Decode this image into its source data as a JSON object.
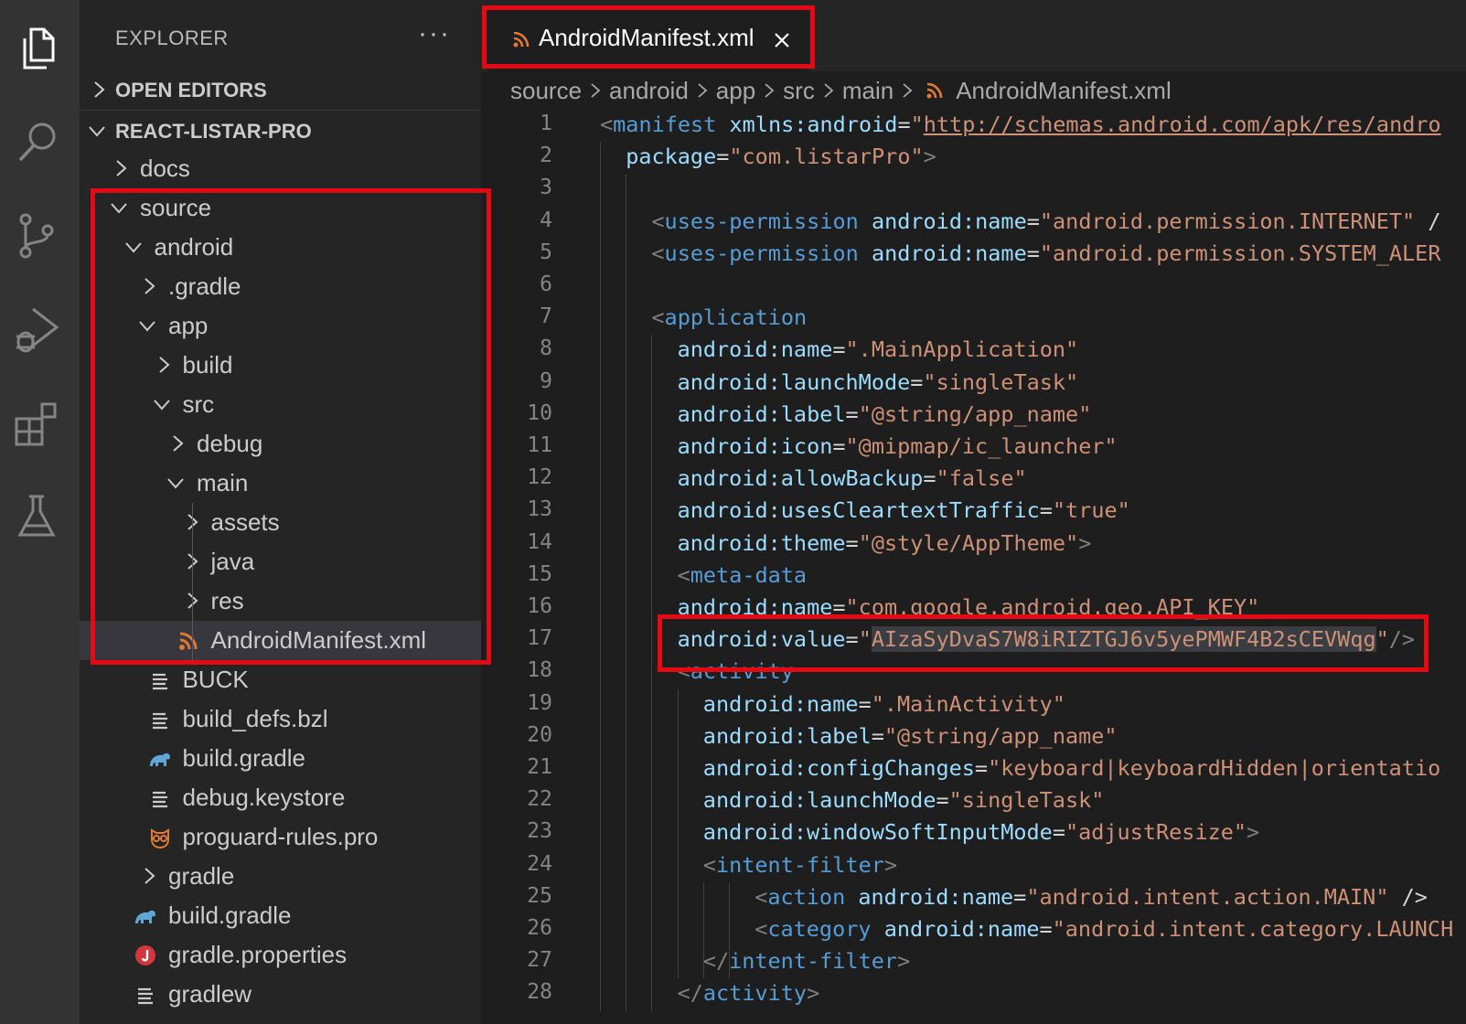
{
  "explorer": {
    "title": "EXPLORER",
    "more": "···",
    "sections": [
      {
        "label": "OPEN EDITORS",
        "expanded": false
      },
      {
        "label": "REACT-LISTAR-PRO",
        "expanded": true
      }
    ],
    "tree": [
      {
        "label": "docs",
        "depth": 0,
        "kind": "folder",
        "expanded": false
      },
      {
        "label": "source",
        "depth": 0,
        "kind": "folder",
        "expanded": true
      },
      {
        "label": "android",
        "depth": 1,
        "kind": "folder",
        "expanded": true
      },
      {
        "label": ".gradle",
        "depth": 2,
        "kind": "folder",
        "expanded": false
      },
      {
        "label": "app",
        "depth": 2,
        "kind": "folder",
        "expanded": true
      },
      {
        "label": "build",
        "depth": 3,
        "kind": "folder",
        "expanded": false
      },
      {
        "label": "src",
        "depth": 3,
        "kind": "folder",
        "expanded": true
      },
      {
        "label": "debug",
        "depth": 4,
        "kind": "folder",
        "expanded": false
      },
      {
        "label": "main",
        "depth": 4,
        "kind": "folder",
        "expanded": true
      },
      {
        "label": "assets",
        "depth": 5,
        "kind": "folder",
        "expanded": false
      },
      {
        "label": "java",
        "depth": 5,
        "kind": "folder",
        "expanded": false
      },
      {
        "label": "res",
        "depth": 5,
        "kind": "folder",
        "expanded": false
      },
      {
        "label": "AndroidManifest.xml",
        "depth": 5,
        "kind": "xml",
        "selected": true
      },
      {
        "label": "BUCK",
        "depth": 3,
        "kind": "text"
      },
      {
        "label": "build_defs.bzl",
        "depth": 3,
        "kind": "text"
      },
      {
        "label": "build.gradle",
        "depth": 3,
        "kind": "gradle"
      },
      {
        "label": "debug.keystore",
        "depth": 3,
        "kind": "text"
      },
      {
        "label": "proguard-rules.pro",
        "depth": 3,
        "kind": "proguard"
      },
      {
        "label": "gradle",
        "depth": 2,
        "kind": "folder",
        "expanded": false
      },
      {
        "label": "build.gradle",
        "depth": 2,
        "kind": "gradle"
      },
      {
        "label": "gradle.properties",
        "depth": 2,
        "kind": "properties"
      },
      {
        "label": "gradlew",
        "depth": 2,
        "kind": "text"
      }
    ]
  },
  "tab": {
    "label": "AndroidManifest.xml",
    "icon": "rss-icon"
  },
  "breadcrumb": [
    "source",
    "android",
    "app",
    "src",
    "main",
    "AndroidManifest.xml"
  ],
  "code_lines": [
    {
      "n": "1",
      "indent": 0,
      "tokens": [
        [
          "br",
          "<"
        ],
        [
          "tag",
          "manifest"
        ],
        [
          "txt",
          " "
        ],
        [
          "attr",
          "xmlns:android"
        ],
        [
          "eq",
          "="
        ],
        [
          "str",
          "\""
        ],
        [
          "url",
          "http://schemas.android.com/apk/res/andro"
        ]
      ]
    },
    {
      "n": "2",
      "indent": 1,
      "tokens": [
        [
          "attr",
          "package"
        ],
        [
          "eq",
          "="
        ],
        [
          "str",
          "\"com.listarPro\""
        ],
        [
          "br",
          ">"
        ]
      ]
    },
    {
      "n": "3",
      "indent": 0,
      "tokens": []
    },
    {
      "n": "4",
      "indent": 2,
      "tokens": [
        [
          "br",
          "<"
        ],
        [
          "tag",
          "uses-permission"
        ],
        [
          "txt",
          " "
        ],
        [
          "attr",
          "android:name"
        ],
        [
          "eq",
          "="
        ],
        [
          "str",
          "\"android.permission.INTERNET\""
        ],
        [
          "txt",
          " /"
        ]
      ]
    },
    {
      "n": "5",
      "indent": 2,
      "tokens": [
        [
          "br",
          "<"
        ],
        [
          "tag",
          "uses-permission"
        ],
        [
          "txt",
          " "
        ],
        [
          "attr",
          "android:name"
        ],
        [
          "eq",
          "="
        ],
        [
          "str",
          "\"android.permission.SYSTEM_ALER"
        ]
      ]
    },
    {
      "n": "6",
      "indent": 0,
      "tokens": []
    },
    {
      "n": "7",
      "indent": 2,
      "tokens": [
        [
          "br",
          "<"
        ],
        [
          "tag",
          "application"
        ]
      ]
    },
    {
      "n": "8",
      "indent": 3,
      "tokens": [
        [
          "attr",
          "android:name"
        ],
        [
          "eq",
          "="
        ],
        [
          "str",
          "\".MainApplication\""
        ]
      ]
    },
    {
      "n": "9",
      "indent": 3,
      "tokens": [
        [
          "attr",
          "android:launchMode"
        ],
        [
          "eq",
          "="
        ],
        [
          "str",
          "\"singleTask\""
        ]
      ]
    },
    {
      "n": "10",
      "indent": 3,
      "tokens": [
        [
          "attr",
          "android:label"
        ],
        [
          "eq",
          "="
        ],
        [
          "str",
          "\"@string/app_name\""
        ]
      ]
    },
    {
      "n": "11",
      "indent": 3,
      "tokens": [
        [
          "attr",
          "android:icon"
        ],
        [
          "eq",
          "="
        ],
        [
          "str",
          "\"@mipmap/ic_launcher\""
        ]
      ]
    },
    {
      "n": "12",
      "indent": 3,
      "tokens": [
        [
          "attr",
          "android:allowBackup"
        ],
        [
          "eq",
          "="
        ],
        [
          "str",
          "\"false\""
        ]
      ]
    },
    {
      "n": "13",
      "indent": 3,
      "tokens": [
        [
          "attr",
          "android:usesCleartextTraffic"
        ],
        [
          "eq",
          "="
        ],
        [
          "str",
          "\"true\""
        ]
      ]
    },
    {
      "n": "14",
      "indent": 3,
      "tokens": [
        [
          "attr",
          "android:theme"
        ],
        [
          "eq",
          "="
        ],
        [
          "str",
          "\"@style/AppTheme\""
        ],
        [
          "br",
          ">"
        ]
      ]
    },
    {
      "n": "15",
      "indent": 3,
      "tokens": [
        [
          "br",
          "<"
        ],
        [
          "tag",
          "meta-data"
        ]
      ]
    },
    {
      "n": "16",
      "indent": 3,
      "tokens": [
        [
          "attr",
          "android:name"
        ],
        [
          "eq",
          "="
        ],
        [
          "str",
          "\"com.google.android.geo.API_KEY\""
        ]
      ]
    },
    {
      "n": "17",
      "indent": 3,
      "tokens": [
        [
          "attr",
          "android:value"
        ],
        [
          "eq",
          "="
        ],
        [
          "str",
          "\""
        ],
        [
          "key",
          "AIzaSyDvaS7W8iRIZTGJ6v5yePMWF4B2sCEVWqg"
        ],
        [
          "str",
          "\""
        ],
        [
          "br",
          "/>"
        ]
      ]
    },
    {
      "n": "18",
      "indent": 3,
      "tokens": [
        [
          "br",
          "<"
        ],
        [
          "tag",
          "activity"
        ]
      ]
    },
    {
      "n": "19",
      "indent": 4,
      "tokens": [
        [
          "attr",
          "android:name"
        ],
        [
          "eq",
          "="
        ],
        [
          "str",
          "\".MainActivity\""
        ]
      ]
    },
    {
      "n": "20",
      "indent": 4,
      "tokens": [
        [
          "attr",
          "android:label"
        ],
        [
          "eq",
          "="
        ],
        [
          "str",
          "\"@string/app_name\""
        ]
      ]
    },
    {
      "n": "21",
      "indent": 4,
      "tokens": [
        [
          "attr",
          "android:configChanges"
        ],
        [
          "eq",
          "="
        ],
        [
          "str",
          "\"keyboard|keyboardHidden|orientatio"
        ]
      ]
    },
    {
      "n": "22",
      "indent": 4,
      "tokens": [
        [
          "attr",
          "android:launchMode"
        ],
        [
          "eq",
          "="
        ],
        [
          "str",
          "\"singleTask\""
        ]
      ]
    },
    {
      "n": "23",
      "indent": 4,
      "tokens": [
        [
          "attr",
          "android:windowSoftInputMode"
        ],
        [
          "eq",
          "="
        ],
        [
          "str",
          "\"adjustResize\""
        ],
        [
          "br",
          ">"
        ]
      ]
    },
    {
      "n": "24",
      "indent": 4,
      "tokens": [
        [
          "br",
          "<"
        ],
        [
          "tag",
          "intent-filter"
        ],
        [
          "br",
          ">"
        ]
      ]
    },
    {
      "n": "25",
      "indent": 6,
      "tokens": [
        [
          "br",
          "<"
        ],
        [
          "tag",
          "action"
        ],
        [
          "txt",
          " "
        ],
        [
          "attr",
          "android:name"
        ],
        [
          "eq",
          "="
        ],
        [
          "str",
          "\"android.intent.action.MAIN\""
        ],
        [
          "txt",
          " />"
        ]
      ]
    },
    {
      "n": "26",
      "indent": 6,
      "tokens": [
        [
          "br",
          "<"
        ],
        [
          "tag",
          "category"
        ],
        [
          "txt",
          " "
        ],
        [
          "attr",
          "android:name"
        ],
        [
          "eq",
          "="
        ],
        [
          "str",
          "\"android.intent.category.LAUNCH"
        ]
      ]
    },
    {
      "n": "27",
      "indent": 4,
      "tokens": [
        [
          "br",
          "</"
        ],
        [
          "tag",
          "intent-filter"
        ],
        [
          "br",
          ">"
        ]
      ]
    },
    {
      "n": "28",
      "indent": 3,
      "tokens": [
        [
          "br",
          "</"
        ],
        [
          "tag",
          "activity"
        ],
        [
          "br",
          ">"
        ]
      ]
    }
  ],
  "colors": {
    "highlight": "#e50914",
    "accent": "#e37933"
  }
}
